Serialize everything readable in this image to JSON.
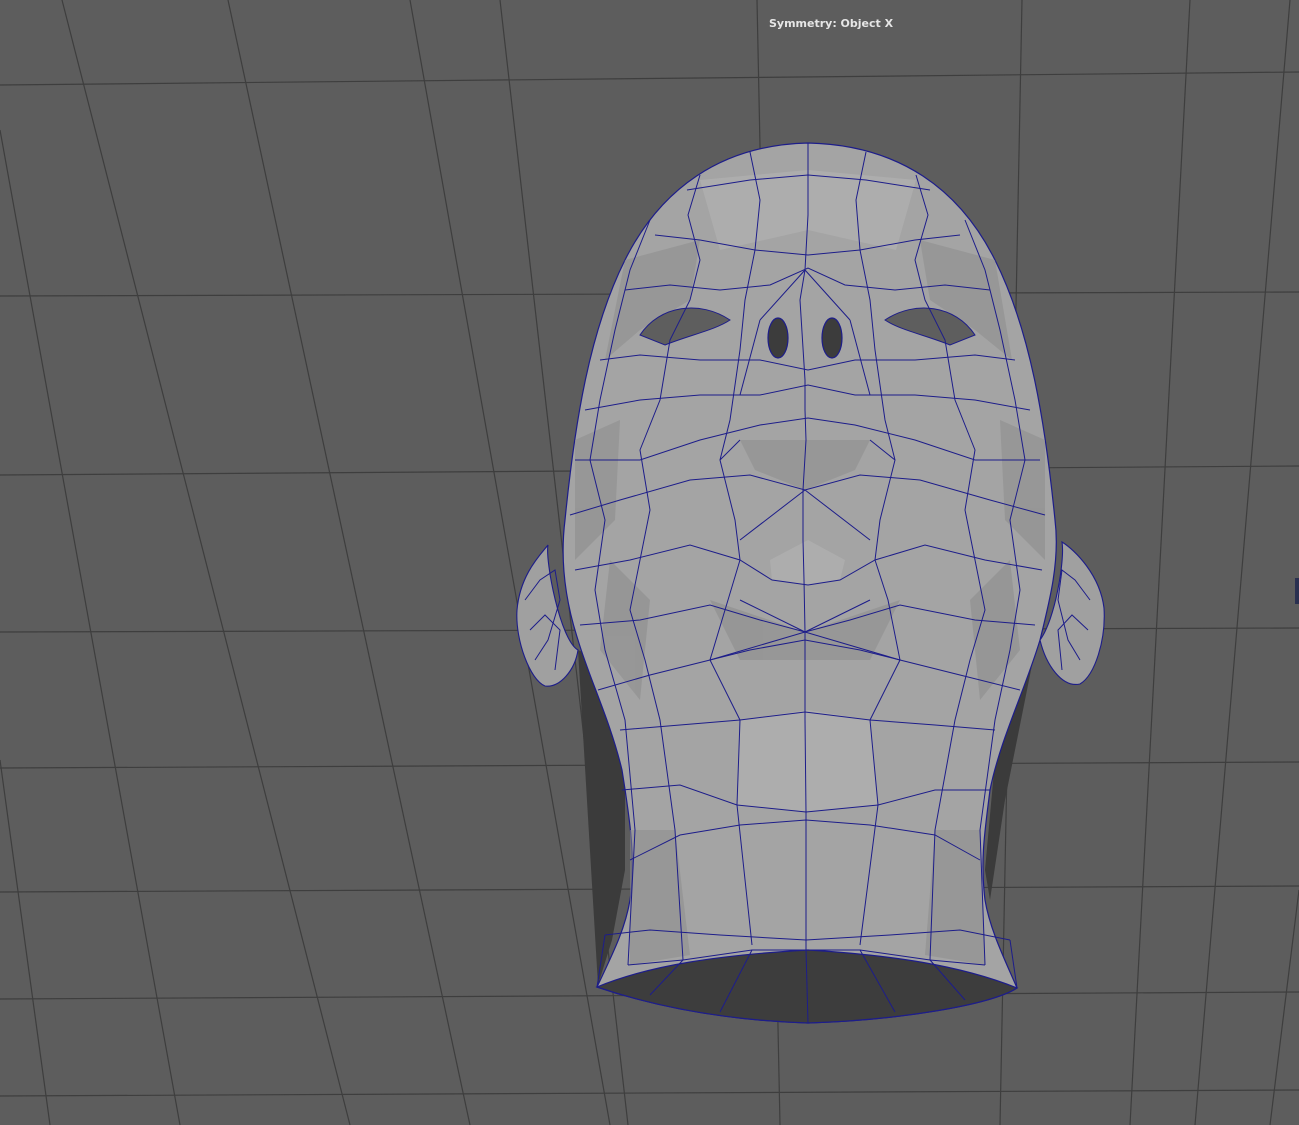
{
  "viewport": {
    "hud": {
      "symmetry_label": "Symmetry: Object X"
    },
    "scene": {
      "background_color": "#5d5d5d",
      "grid_color": "#3e3e3e",
      "mesh_fill_light": "#a6a6a6",
      "mesh_fill_mid": "#9a9a9a",
      "mesh_fill_dark": "#8a8a8a",
      "mesh_interior": "#3a3a3a",
      "wireframe_color": "#1d1d8a",
      "object": "head-mesh"
    }
  }
}
